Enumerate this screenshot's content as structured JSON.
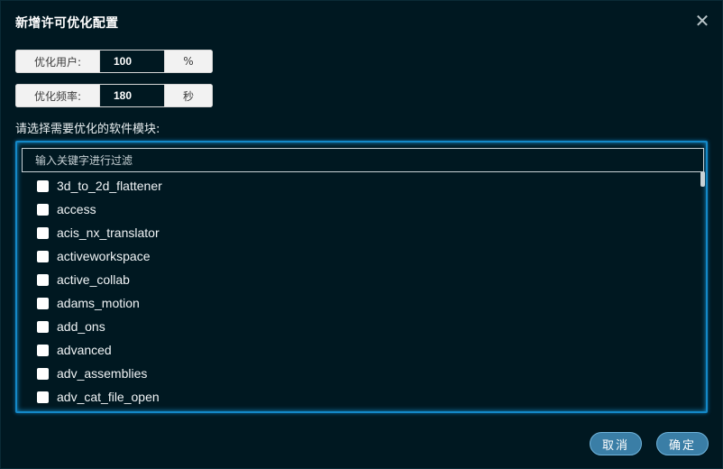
{
  "dialog": {
    "title": "新增许可优化配置",
    "close_glyph": "✕"
  },
  "fields": {
    "users_label": "优化用户:",
    "users_value": "100",
    "users_unit": "%",
    "freq_label": "优化频率:",
    "freq_value": "180",
    "freq_unit": "秒"
  },
  "modules": {
    "section_label": "请选择需要优化的软件模块:",
    "filter_placeholder": "输入关键字进行过滤",
    "items": [
      "3d_to_2d_flattener",
      "access",
      "acis_nx_translator",
      "activeworkspace",
      "active_collab",
      "adams_motion",
      "add_ons",
      "advanced",
      "adv_assemblies",
      "adv_cat_file_open"
    ]
  },
  "footer": {
    "cancel_label": "取消",
    "ok_label": "确定"
  },
  "colors": {
    "background": "#001821",
    "panel_border": "#1489c8",
    "button": "#3a7ea6"
  }
}
